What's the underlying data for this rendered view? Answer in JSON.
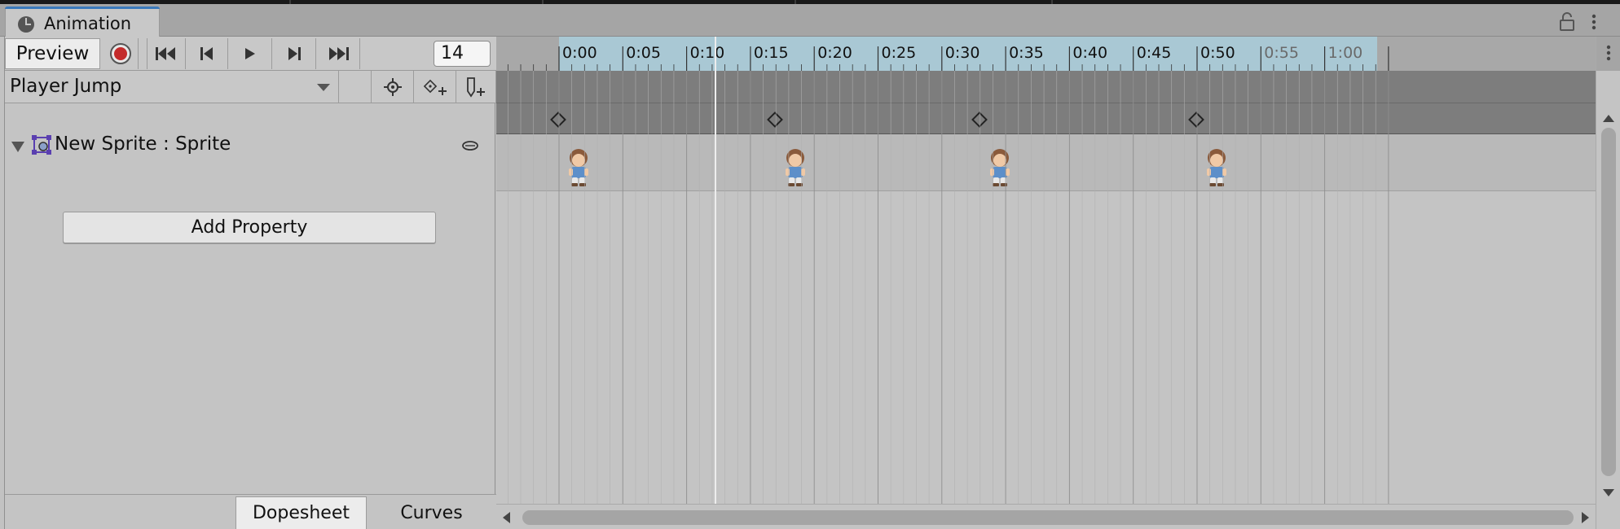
{
  "window": {
    "tab_label": "Animation",
    "tab_icon": "clock-icon",
    "lock_icon": "lock-icon",
    "menu_icon": "kebab-menu-icon"
  },
  "toolbar": {
    "preview_label": "Preview",
    "record_icon": "record-icon",
    "first_frame_icon": "first-keyframe-icon",
    "prev_frame_icon": "previous-keyframe-icon",
    "play_icon": "play-icon",
    "next_frame_icon": "next-keyframe-icon",
    "last_frame_icon": "last-keyframe-icon",
    "frame_value": "14",
    "record_color": "#c42b2b"
  },
  "clip": {
    "name": "Player Jump",
    "snap_icon": "snap-target-icon",
    "add_keyframe_icon": "add-keyframe-icon",
    "add_event_icon": "add-event-icon"
  },
  "properties": [
    {
      "label": "New Sprite : Sprite",
      "icon": "sprite-renderer-icon",
      "visibility_icon": "eye-icon"
    }
  ],
  "add_property_label": "Add Property",
  "bottom_tabs": {
    "dopesheet": "Dopesheet",
    "curves": "Curves"
  },
  "timeline": {
    "ruler_labels": [
      "0:00",
      "0:05",
      "0:10",
      "0:15",
      "0:20",
      "0:25",
      "0:30",
      "0:35",
      "0:40",
      "0:45",
      "0:50",
      "0:55",
      "1:00"
    ],
    "current_frame": 14,
    "clip_end_frame": 50,
    "keyframe_frames": [
      0,
      17,
      33,
      50
    ],
    "active_range_color": "#a9c8d4",
    "playhead_color": "#ededed"
  }
}
